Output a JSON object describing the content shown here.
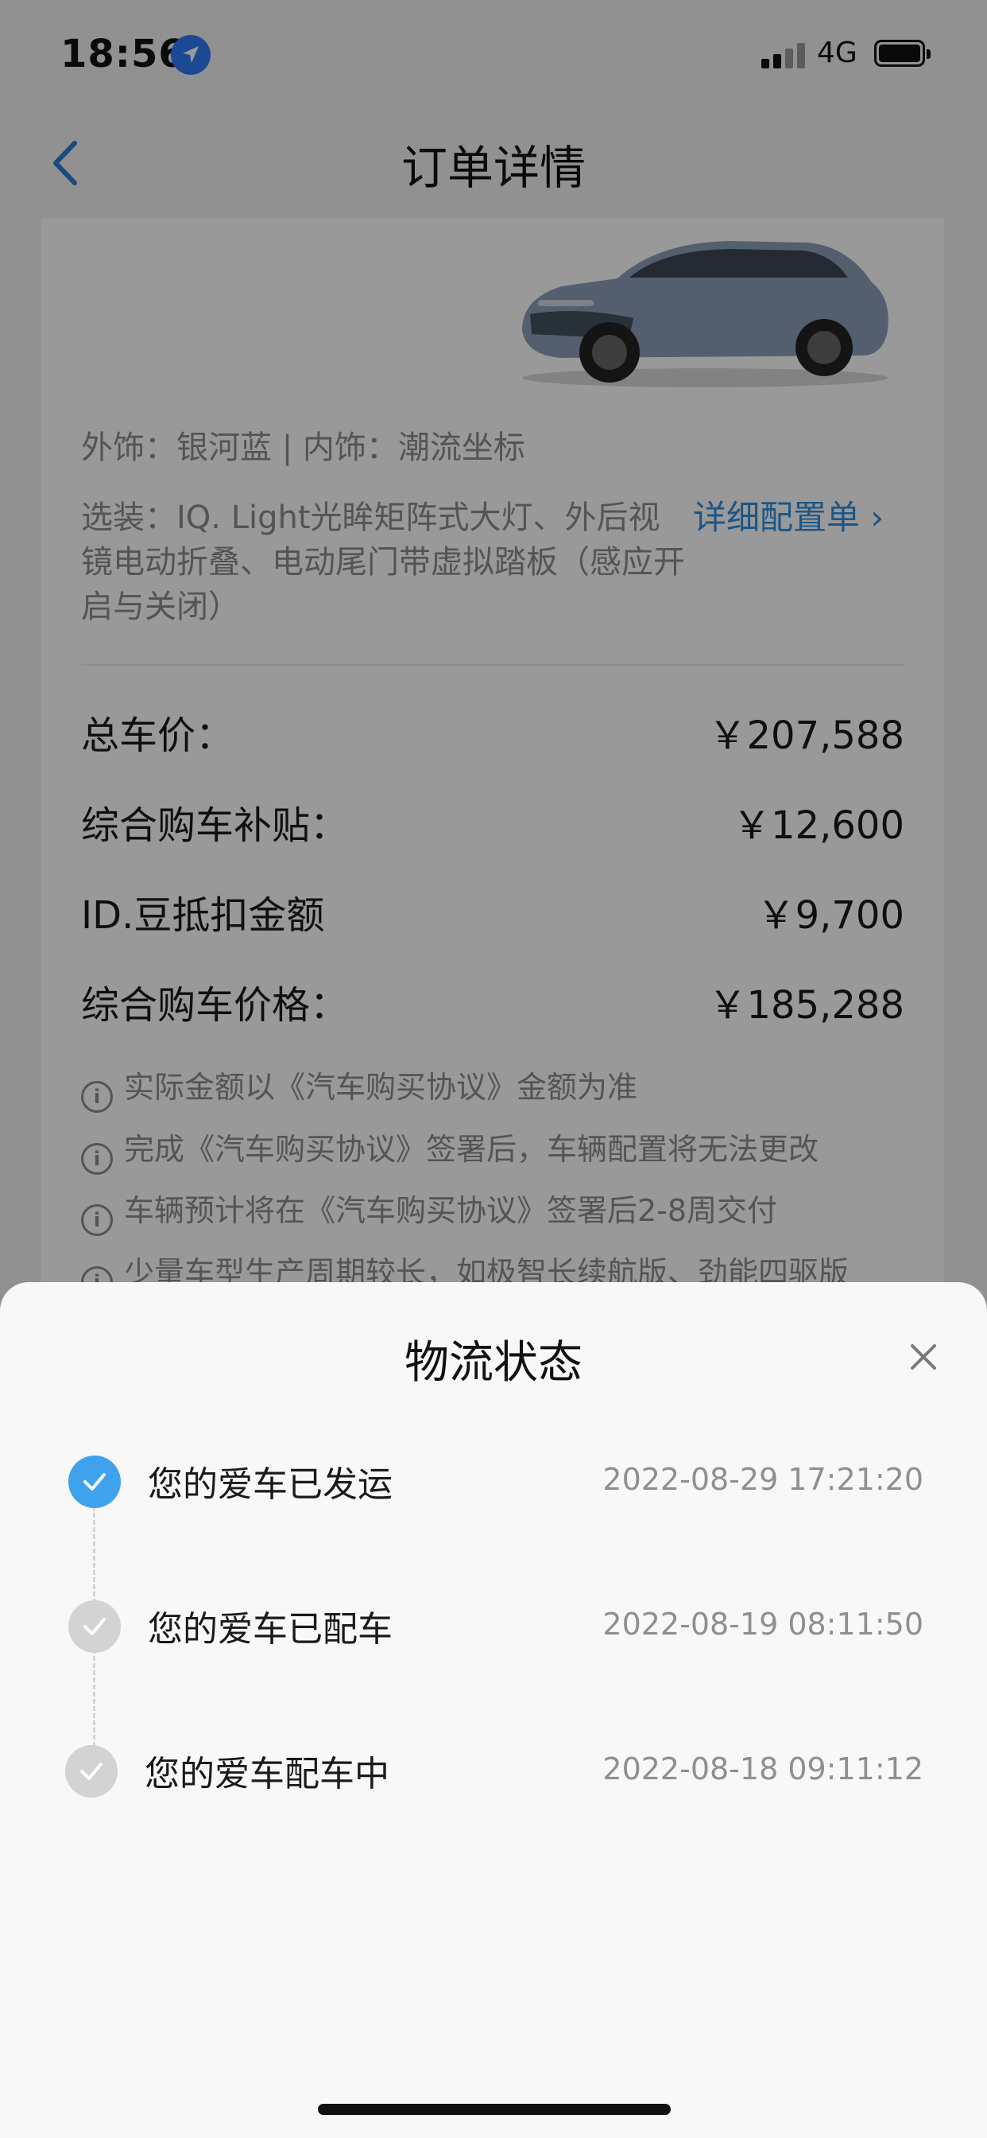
{
  "status_bar": {
    "time": "18:56",
    "network": "4G"
  },
  "nav": {
    "title": "订单详情"
  },
  "order": {
    "exterior_interior": "外饰：银河蓝 | 内饰：潮流坐标",
    "options": "选装：IQ. Light光眸矩阵式大灯、外后视镜电动折叠、电动尾门带虚拟踏板（感应开启与关闭）",
    "detail_link": "详细配置单 ›",
    "prices": [
      {
        "label": "总车价：",
        "value": "￥207,588"
      },
      {
        "label": "综合购车补贴：",
        "value": "￥12,600"
      },
      {
        "label": "ID.豆抵扣金额",
        "value": "￥9,700"
      },
      {
        "label": "综合购车价格：",
        "value": "￥185,288"
      }
    ],
    "notes": [
      "实际金额以《汽车购买协议》金额为准",
      "完成《汽车购买协议》签署后，车辆配置将无法更改",
      "车辆预计将在《汽车购买协议》签署后2-8周交付",
      "少量车型生产周期较长，如极智长续航版、劲能四驱版"
    ]
  },
  "logistics": {
    "title": "物流状态",
    "items": [
      {
        "text": "您的爱车已发运",
        "time": "2022-08-29 17:21:20",
        "active": true
      },
      {
        "text": "您的爱车已配车",
        "time": "2022-08-19 08:11:50",
        "active": false
      },
      {
        "text": "您的爱车配车中",
        "time": "2022-08-18 09:11:12",
        "active": false
      }
    ]
  },
  "colors": {
    "accent": "#3ea2ef",
    "link": "#2f8fe0",
    "inactive_dot": "#d3d3d3"
  }
}
